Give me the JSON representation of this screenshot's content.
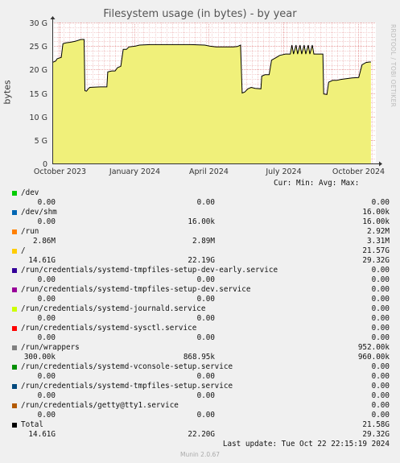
{
  "header": {
    "title": "Filesystem usage (in bytes) - by year",
    "side_text": "RRDTOOL / TOBI OETIKER",
    "footer": "Munin 2.0.67",
    "last_update": "Last update: Tue Oct 22 22:15:19 2024",
    "legend_columns": "Cur: Min: Avg: Max:"
  },
  "chart_data": {
    "type": "line",
    "title": "Filesystem usage (in bytes) - by year",
    "ylabel": "bytes",
    "ylim": [
      0,
      30
    ],
    "y_unit": "G",
    "y_ticks": [
      "0",
      "5 G",
      "10 G",
      "15 G",
      "20 G",
      "25 G",
      "30 G"
    ],
    "y_tick_values": [
      0,
      5,
      10,
      15,
      20,
      25,
      30
    ],
    "x_ticks": [
      "October 2023",
      "January 2024",
      "April 2024",
      "July 2024",
      "October 2024"
    ],
    "x_tick_values": [
      "2023-10-01",
      "2024-01-01",
      "2024-04-01",
      "2024-07-01",
      "2024-10-01"
    ],
    "xlim": [
      "2023-09-22",
      "2024-10-23"
    ],
    "grid": true,
    "grid_color": "#e8a0a0",
    "line_color": "#000000",
    "fill_color": "#f0f07a",
    "series": [
      {
        "name": "Total",
        "points": [
          [
            "2023-09-22",
            21.5
          ],
          [
            "2023-09-26",
            21.8
          ],
          [
            "2023-09-28",
            22.3
          ],
          [
            "2023-10-03",
            22.6
          ],
          [
            "2023-10-05",
            25.5
          ],
          [
            "2023-10-09",
            25.7
          ],
          [
            "2023-10-14",
            25.8
          ],
          [
            "2023-10-20",
            26.0
          ],
          [
            "2023-10-27",
            26.4
          ],
          [
            "2023-10-31",
            26.4
          ],
          [
            "2023-11-01",
            15.5
          ],
          [
            "2023-11-03",
            15.4
          ],
          [
            "2023-11-05",
            15.9
          ],
          [
            "2023-11-07",
            16.2
          ],
          [
            "2023-11-20",
            16.3
          ],
          [
            "2023-11-28",
            16.3
          ],
          [
            "2023-11-29",
            19.5
          ],
          [
            "2023-12-04",
            19.7
          ],
          [
            "2023-12-08",
            19.7
          ],
          [
            "2023-12-11",
            20.4
          ],
          [
            "2023-12-15",
            20.7
          ],
          [
            "2023-12-18",
            24.3
          ],
          [
            "2023-12-22",
            24.3
          ],
          [
            "2023-12-25",
            24.8
          ],
          [
            "2024-01-02",
            25.0
          ],
          [
            "2024-01-07",
            25.2
          ],
          [
            "2024-01-20",
            25.3
          ],
          [
            "2024-02-15",
            25.3
          ],
          [
            "2024-02-22",
            25.3
          ],
          [
            "2024-03-10",
            25.3
          ],
          [
            "2024-03-27",
            25.2
          ],
          [
            "2024-04-02",
            25.0
          ],
          [
            "2024-04-10",
            24.8
          ],
          [
            "2024-05-01",
            24.8
          ],
          [
            "2024-05-06",
            24.9
          ],
          [
            "2024-05-10",
            25.2
          ],
          [
            "2024-05-12",
            15.0
          ],
          [
            "2024-05-15",
            15.2
          ],
          [
            "2024-05-19",
            15.9
          ],
          [
            "2024-05-23",
            16.2
          ],
          [
            "2024-05-28",
            16.0
          ],
          [
            "2024-06-04",
            15.9
          ],
          [
            "2024-06-05",
            18.6
          ],
          [
            "2024-06-09",
            18.9
          ],
          [
            "2024-06-14",
            18.9
          ],
          [
            "2024-06-17",
            22.0
          ],
          [
            "2024-06-22",
            22.5
          ],
          [
            "2024-06-27",
            23.0
          ],
          [
            "2024-07-04",
            23.3
          ],
          [
            "2024-07-10",
            23.3
          ],
          [
            "2024-07-12",
            25.2
          ],
          [
            "2024-07-14",
            23.3
          ],
          [
            "2024-07-17",
            25.2
          ],
          [
            "2024-07-19",
            23.3
          ],
          [
            "2024-07-22",
            25.2
          ],
          [
            "2024-07-24",
            23.3
          ],
          [
            "2024-07-27",
            25.2
          ],
          [
            "2024-07-29",
            23.3
          ],
          [
            "2024-08-01",
            25.2
          ],
          [
            "2024-08-03",
            23.3
          ],
          [
            "2024-08-06",
            25.2
          ],
          [
            "2024-08-08",
            23.3
          ],
          [
            "2024-08-15",
            23.3
          ],
          [
            "2024-08-19",
            23.3
          ],
          [
            "2024-08-20",
            14.8
          ],
          [
            "2024-08-24",
            14.7
          ],
          [
            "2024-08-26",
            17.3
          ],
          [
            "2024-08-31",
            17.7
          ],
          [
            "2024-09-05",
            17.7
          ],
          [
            "2024-09-10",
            17.9
          ],
          [
            "2024-09-24",
            18.2
          ],
          [
            "2024-10-02",
            18.3
          ],
          [
            "2024-10-06",
            21.0
          ],
          [
            "2024-10-11",
            21.5
          ],
          [
            "2024-10-15",
            21.6
          ],
          [
            "2024-10-17",
            21.6
          ]
        ]
      }
    ]
  },
  "legend": {
    "entries": [
      {
        "name": "/dev",
        "color": "#00cc00",
        "cur": "0.00",
        "min": "0.00",
        "max": "0.00"
      },
      {
        "name": "/dev/shm",
        "color": "#0066b3",
        "cur": "0.00",
        "min": "16.00k",
        "max": "16.00k",
        "avg": "16.00k"
      },
      {
        "name": "/run",
        "color": "#ff8000",
        "cur": "2.86M",
        "min": "2.89M",
        "max": "3.31M",
        "avg": "2.92M"
      },
      {
        "name": "/",
        "color": "#ffcc00",
        "cur": "14.61G",
        "min": "22.19G",
        "max": "29.32G",
        "avg": "21.57G"
      },
      {
        "name": "/run/credentials/systemd-tmpfiles-setup-dev-early.service",
        "color": "#330099",
        "cur": "0.00",
        "min": "0.00",
        "max": "0.00",
        "avg": "0.00"
      },
      {
        "name": "/run/credentials/systemd-tmpfiles-setup-dev.service",
        "color": "#990099",
        "cur": "0.00",
        "min": "0.00",
        "max": "0.00",
        "avg": "0.00"
      },
      {
        "name": "/run/credentials/systemd-journald.service",
        "color": "#ccff00",
        "cur": "0.00",
        "min": "0.00",
        "max": "0.00",
        "avg": "0.00"
      },
      {
        "name": "/run/credentials/systemd-sysctl.service",
        "color": "#ff0000",
        "cur": "0.00",
        "min": "0.00",
        "max": "0.00",
        "avg": "0.00"
      },
      {
        "name": "/run/wrappers",
        "color": "#808080",
        "cur": "300.00k",
        "min": "868.95k",
        "max": "960.00k",
        "avg": "952.00k"
      },
      {
        "name": "/run/credentials/systemd-vconsole-setup.service",
        "color": "#008f00",
        "cur": "0.00",
        "min": "0.00",
        "max": "0.00",
        "avg": "0.00"
      },
      {
        "name": "/run/credentials/systemd-tmpfiles-setup.service",
        "color": "#00487d",
        "cur": "0.00",
        "min": "0.00",
        "max": "0.00",
        "avg": "0.00"
      },
      {
        "name": "/run/credentials/getty@tty1.service",
        "color": "#b35a00",
        "cur": "0.00",
        "min": "0.00",
        "max": "0.00",
        "avg": "0.00"
      },
      {
        "name": "Total",
        "color": "#000000",
        "cur": "14.61G",
        "min": "22.20G",
        "max": "29.32G",
        "avg": "21.58G"
      }
    ]
  }
}
